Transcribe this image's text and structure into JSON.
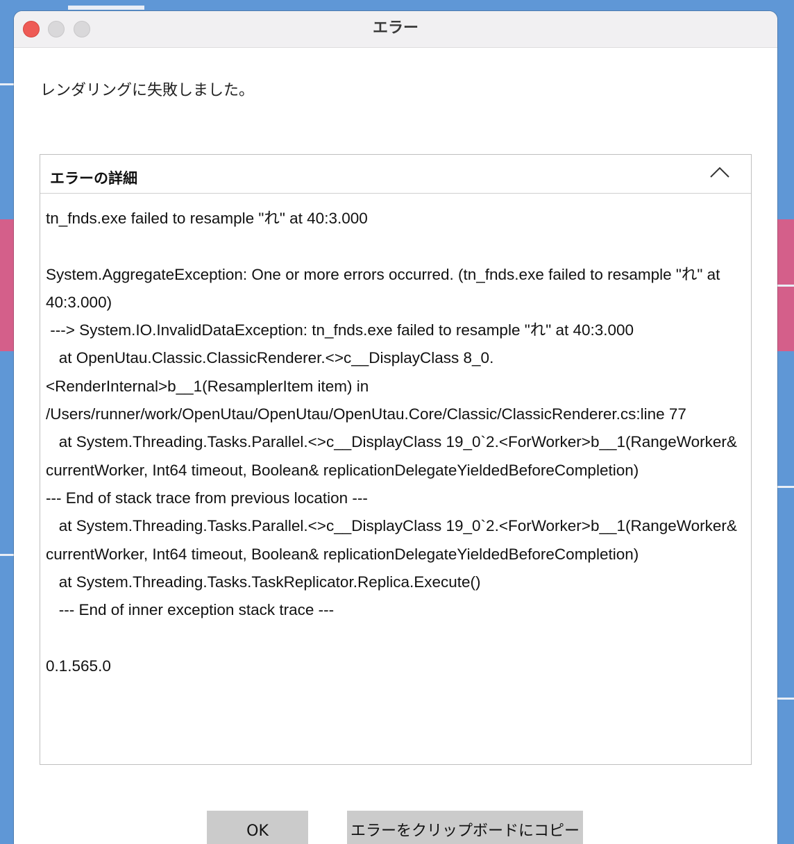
{
  "window": {
    "title": "エラー"
  },
  "message": "レンダリングに失敗しました。",
  "details": {
    "header": "エラーの詳細",
    "text": "tn_fnds.exe failed to resample \"れ\" at 40:3.000\n\nSystem.AggregateException: One or more errors occurred. (tn_fnds.exe failed to resample \"れ\" at 40:3.000)\n ---> System.IO.InvalidDataException: tn_fnds.exe failed to resample \"れ\" at 40:3.000\n   at OpenUtau.Classic.ClassicRenderer.<>c__DisplayClass 8_0.<RenderInternal>b__1(ResamplerItem item) in /Users/runner/work/OpenUtau/OpenUtau/OpenUtau.Core/Classic/ClassicRenderer.cs:line 77\n   at System.Threading.Tasks.Parallel.<>c__DisplayClass 19_0`2.<ForWorker>b__1(RangeWorker& currentWorker, Int64 timeout, Boolean& replicationDelegateYieldedBeforeCompletion)\n--- End of stack trace from previous location ---\n   at System.Threading.Tasks.Parallel.<>c__DisplayClass 19_0`2.<ForWorker>b__1(RangeWorker& currentWorker, Int64 timeout, Boolean& replicationDelegateYieldedBeforeCompletion)\n   at System.Threading.Tasks.TaskReplicator.Replica.Execute()\n   --- End of inner exception stack trace ---\n\n0.1.565.0",
    "collapse_icon": "chevron-up-icon"
  },
  "buttons": {
    "ok": "OK",
    "copy": "エラーをクリップボードにコピー"
  },
  "colors": {
    "background": "#5f97d6",
    "background_accent": "#d45f8a",
    "close": "#ee5b56",
    "button": "#cbcbcb"
  }
}
